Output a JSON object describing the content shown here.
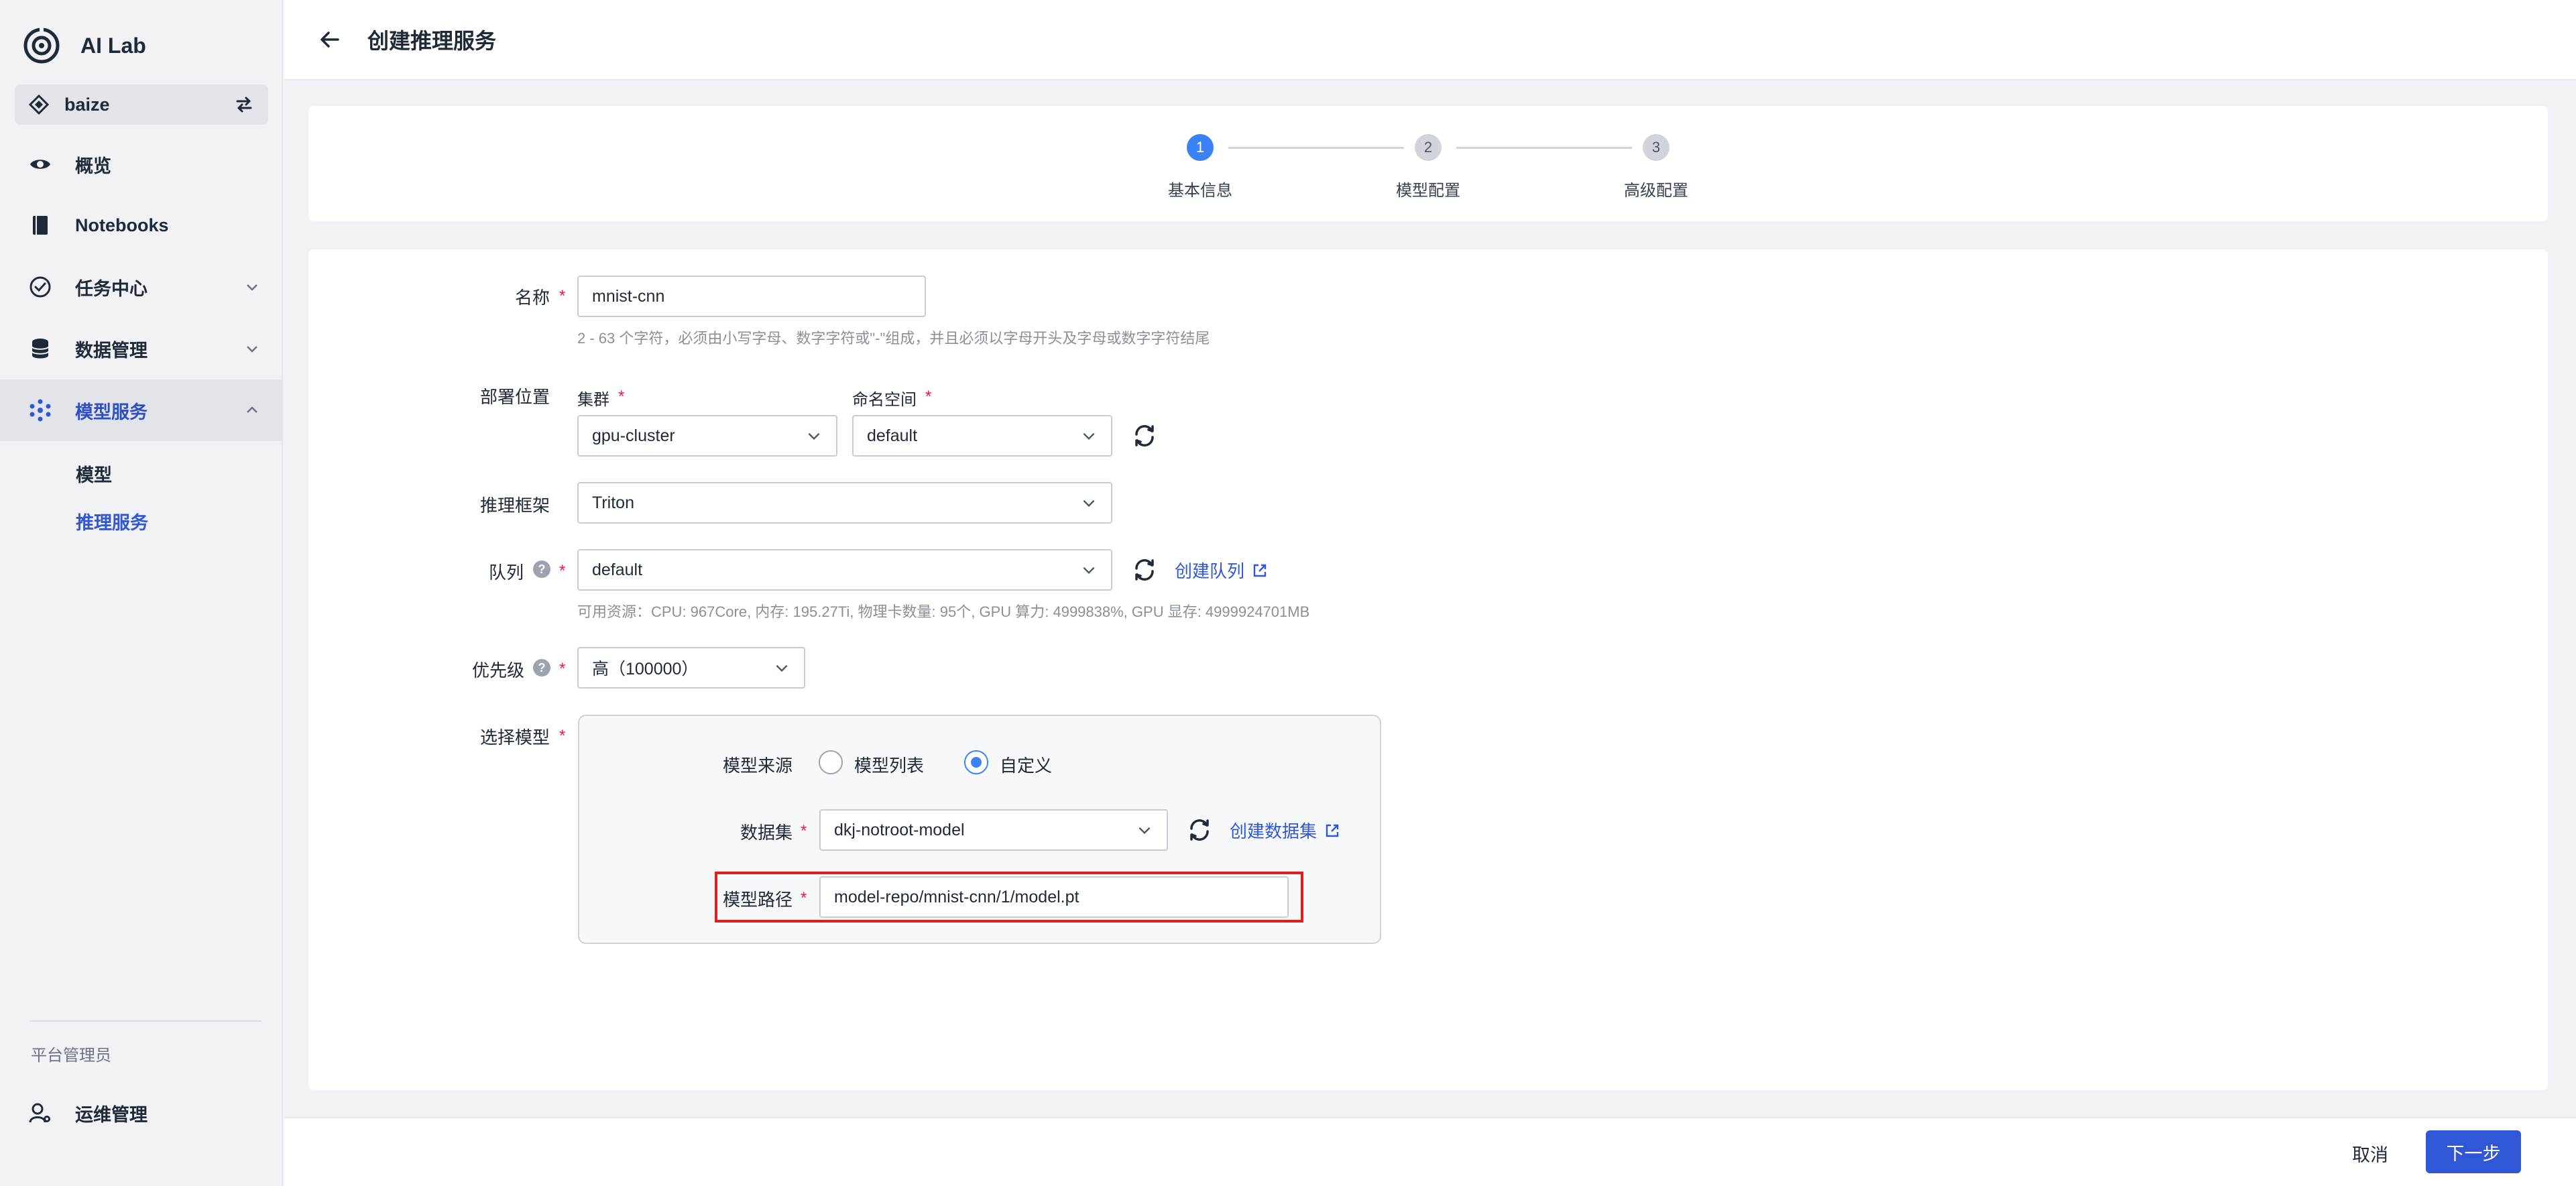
{
  "app": {
    "name": "AI Lab"
  },
  "workspace": {
    "name": "baize"
  },
  "sidebar": {
    "items": [
      {
        "label": "概览",
        "icon": "eye-icon"
      },
      {
        "label": "Notebooks",
        "icon": "notebook-icon"
      },
      {
        "label": "任务中心",
        "icon": "task-check-icon",
        "expandable": true
      },
      {
        "label": "数据管理",
        "icon": "database-icon",
        "expandable": true
      },
      {
        "label": "模型服务",
        "icon": "model-service-icon",
        "expanded": true,
        "active": true
      }
    ],
    "subitems": [
      {
        "label": "模型"
      },
      {
        "label": "推理服务",
        "active": true
      }
    ],
    "section_label": "平台管理员",
    "admin_item": {
      "label": "运维管理",
      "icon": "ops-gear-icon"
    }
  },
  "header": {
    "title": "创建推理服务"
  },
  "steps": [
    {
      "num": "1",
      "label": "基本信息",
      "state": "current"
    },
    {
      "num": "2",
      "label": "模型配置",
      "state": "pending"
    },
    {
      "num": "3",
      "label": "高级配置",
      "state": "pending"
    }
  ],
  "form": {
    "name": {
      "label": "名称",
      "value": "mnist-cnn",
      "hint": "2 - 63 个字符，必须由小写字母、数字字符或\"-\"组成，并且必须以字母开头及字母或数字字符结尾"
    },
    "deploy": {
      "label": "部署位置",
      "cluster_label": "集群",
      "cluster_value": "gpu-cluster",
      "namespace_label": "命名空间",
      "namespace_value": "default"
    },
    "framework": {
      "label": "推理框架",
      "value": "Triton"
    },
    "queue": {
      "label": "队列",
      "value": "default",
      "create_link": "创建队列",
      "hint": "可用资源：CPU: 967Core, 内存: 195.27Ti, 物理卡数量: 95个, GPU 算力: 4999838%, GPU 显存: 4999924701MB"
    },
    "priority": {
      "label": "优先级",
      "value": "高（100000）"
    },
    "model": {
      "label": "选择模型",
      "source_label": "模型来源",
      "source_options": [
        "模型列表",
        "自定义"
      ],
      "source_selected": "自定义",
      "dataset_label": "数据集",
      "dataset_value": "dkj-notroot-model",
      "create_dataset_link": "创建数据集",
      "path_label": "模型路径",
      "path_value": "model-repo/mnist-cnn/1/model.pt"
    }
  },
  "footer": {
    "cancel_label": "取消",
    "next_label": "下一步"
  },
  "colors": {
    "accent": "#2f57d6",
    "step_active": "#3b82f6",
    "required": "#e11d48",
    "highlight": "#e02020"
  }
}
